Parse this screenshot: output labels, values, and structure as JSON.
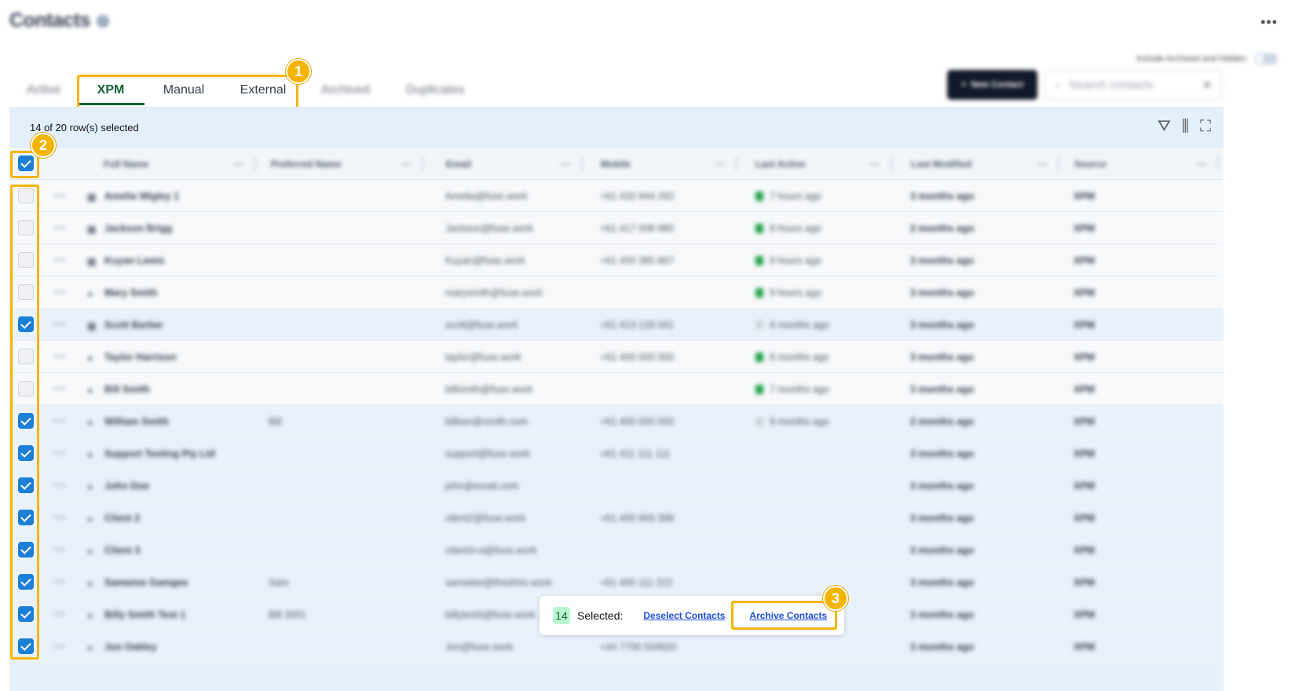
{
  "header": {
    "title": "Contacts",
    "info_icon": "info-icon",
    "more_label": "•••",
    "archived_toggle_label": "Include Archived and Hidden"
  },
  "tabs": [
    {
      "label": "Active",
      "active": false,
      "blurred": true
    },
    {
      "label": "XPM",
      "active": true,
      "blurred": false
    },
    {
      "label": "Manual",
      "active": false,
      "blurred": false
    },
    {
      "label": "External",
      "active": false,
      "blurred": false
    },
    {
      "label": "Archived",
      "active": false,
      "blurred": true
    },
    {
      "label": "Duplicates",
      "active": false,
      "blurred": true
    }
  ],
  "toolbar": {
    "new_contact_label": "New Contact",
    "search_placeholder": "Search contacts"
  },
  "selection": {
    "summary": "14 of 20 row(s) selected"
  },
  "columns": [
    "Full Name",
    "Preferred Name",
    "Email",
    "Mobile",
    "Last Active",
    "Last Modified",
    "Source"
  ],
  "rows": [
    {
      "selected": false,
      "name": "Amelia Wigley 1",
      "pref": "",
      "email": "Amelia@fuse.work",
      "mobile": "+61 432 944 292",
      "last_active": "7 hours ago",
      "active_icon": "green",
      "modified": "3 months ago",
      "source": "XPM",
      "type": "org"
    },
    {
      "selected": false,
      "name": "Jackson Brigg",
      "pref": "",
      "email": "Jackson@fuse.work",
      "mobile": "+61 417 008 980",
      "last_active": "8 hours ago",
      "active_icon": "green",
      "modified": "2 months ago",
      "source": "XPM",
      "type": "org"
    },
    {
      "selected": false,
      "name": "Kuyan Lewis",
      "pref": "",
      "email": "Kuyan@fuse.work",
      "mobile": "+61 450 385 667",
      "last_active": "9 hours ago",
      "active_icon": "green",
      "modified": "3 months ago",
      "source": "XPM",
      "type": "org"
    },
    {
      "selected": false,
      "name": "Mary Smith",
      "pref": "",
      "email": "marysmith@fuse.work",
      "mobile": "",
      "last_active": "9 hours ago",
      "active_icon": "green",
      "modified": "3 months ago",
      "source": "XPM",
      "type": "person"
    },
    {
      "selected": true,
      "name": "Scott Barber",
      "pref": "",
      "email": "scott@fuse.work",
      "mobile": "+61 413 129 041",
      "last_active": "4 months ago",
      "active_icon": "pale",
      "modified": "3 months ago",
      "source": "XPM",
      "type": "org"
    },
    {
      "selected": false,
      "name": "Taylor Harrison",
      "pref": "",
      "email": "taylor@fuse.work",
      "mobile": "+61 400 000 000",
      "last_active": "6 months ago",
      "active_icon": "green",
      "modified": "3 months ago",
      "source": "XPM",
      "type": "person"
    },
    {
      "selected": false,
      "name": "Bill Smith",
      "pref": "",
      "email": "billsmith@fuse.work",
      "mobile": "",
      "last_active": "7 months ago",
      "active_icon": "green",
      "modified": "3 months ago",
      "source": "XPM",
      "type": "person"
    },
    {
      "selected": true,
      "name": "William Smith",
      "pref": "Bill",
      "email": "billiam@smith.com",
      "mobile": "+61 400 000 000",
      "last_active": "9 months ago",
      "active_icon": "pale",
      "modified": "2 months ago",
      "source": "XPM",
      "type": "person"
    },
    {
      "selected": true,
      "name": "Support Testing Pty Ltd",
      "pref": "",
      "email": "support@fuse.work",
      "mobile": "+61 411 111 111",
      "last_active": "",
      "active_icon": "",
      "modified": "3 months ago",
      "source": "XPM",
      "type": "person"
    },
    {
      "selected": true,
      "name": "John Doe",
      "pref": "",
      "email": "john@email.com",
      "mobile": "",
      "last_active": "",
      "active_icon": "",
      "modified": "3 months ago",
      "source": "XPM",
      "type": "person"
    },
    {
      "selected": true,
      "name": "Client 2",
      "pref": "",
      "email": "client2@fuse.work",
      "mobile": "+61 400 900 398",
      "last_active": "",
      "active_icon": "",
      "modified": "3 months ago",
      "source": "XPM",
      "type": "person"
    },
    {
      "selected": true,
      "name": "Client 3",
      "pref": "",
      "email": "client3+a@fuse.work",
      "mobile": "",
      "last_active": "",
      "active_icon": "",
      "modified": "3 months ago",
      "source": "XPM",
      "type": "person"
    },
    {
      "selected": true,
      "name": "Samwise Gamgee",
      "pref": "Sam",
      "email": "samwise@theshire.work",
      "mobile": "+61 400 111 222",
      "last_active": "",
      "active_icon": "",
      "modified": "3 months ago",
      "source": "XPM",
      "type": "person"
    },
    {
      "selected": true,
      "name": "Billy Smith Test 1",
      "pref": "Bill 3001",
      "email": "billytest3@fuse.work",
      "mobile": "",
      "last_active": "",
      "active_icon": "",
      "modified": "3 months ago",
      "source": "XPM",
      "type": "person"
    },
    {
      "selected": true,
      "name": "Jon Oakley",
      "pref": "",
      "email": "Jon@fuse.work",
      "mobile": "+44 7700 534620",
      "last_active": "",
      "active_icon": "",
      "modified": "3 months ago",
      "source": "XPM",
      "type": "person"
    }
  ],
  "action_bar": {
    "count": "14",
    "selected_label": "Selected:",
    "deselect_label": "Deselect Contacts",
    "archive_label": "Archive Contacts"
  },
  "callouts": [
    "1",
    "2",
    "3"
  ],
  "colors": {
    "brand_green": "#166534",
    "highlight": "#f5b400",
    "checkbox_blue": "#1d7fd6",
    "link_blue": "#1d4ed8"
  }
}
